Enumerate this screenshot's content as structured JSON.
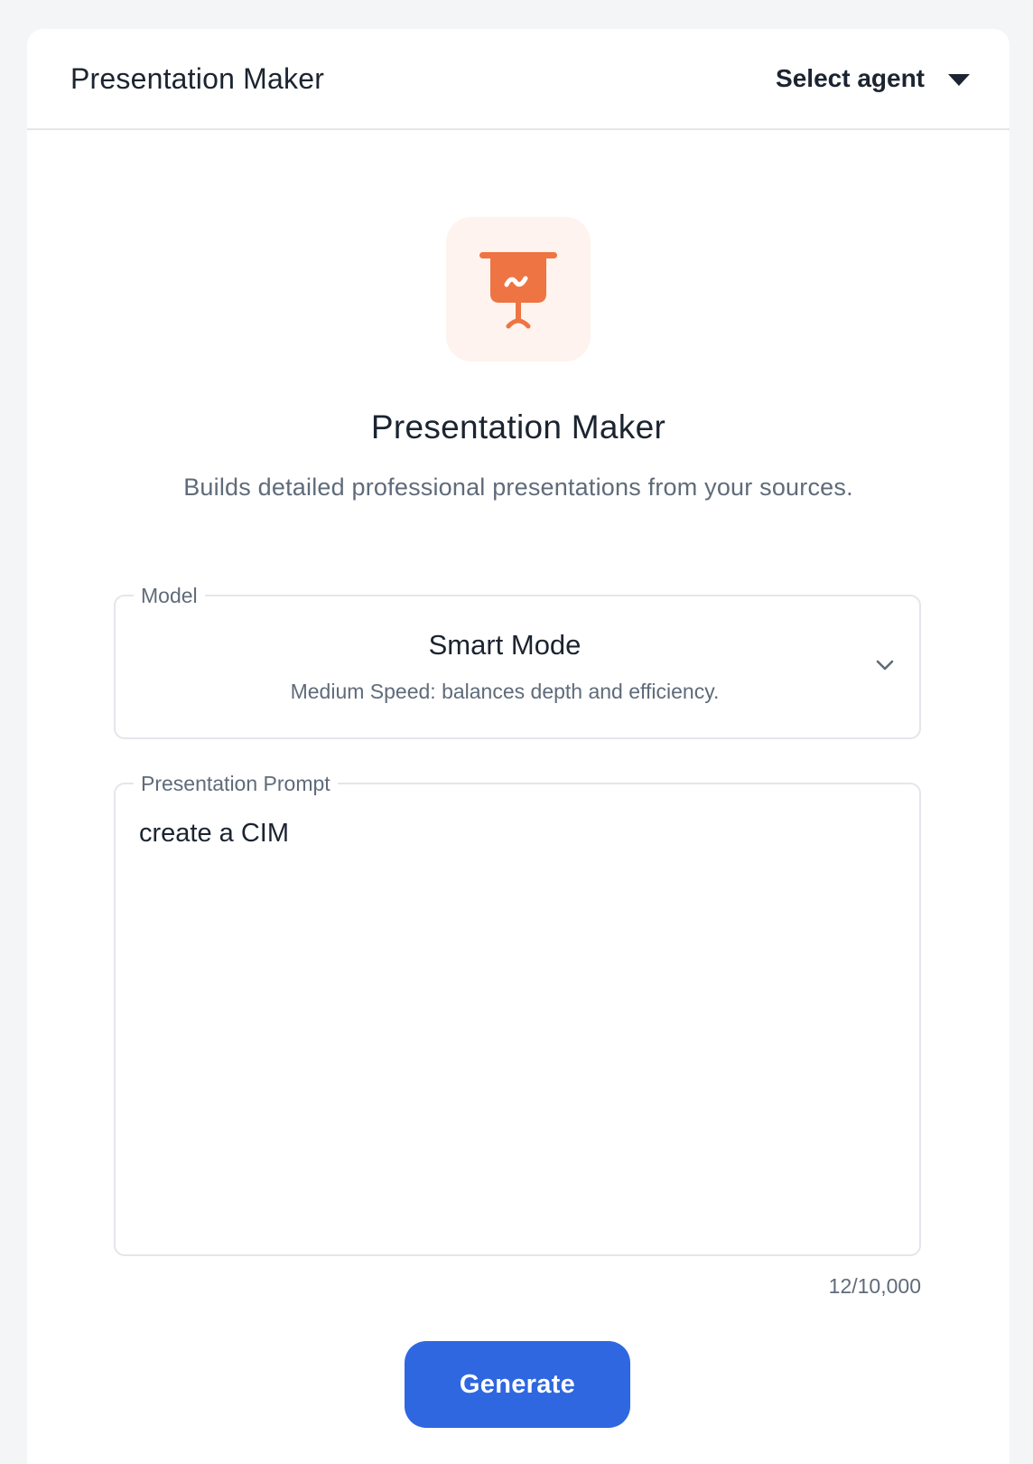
{
  "header": {
    "title": "Presentation Maker",
    "agent_select_label": "Select agent"
  },
  "agent": {
    "icon": "presentation-board-icon",
    "name": "Presentation Maker",
    "description": "Builds detailed professional presentations from your sources."
  },
  "model": {
    "legend": "Model",
    "selected_name": "Smart Mode",
    "selected_description": "Medium Speed: balances depth and efficiency."
  },
  "prompt": {
    "legend": "Presentation Prompt",
    "value": "create a CIM",
    "char_count": "12/10,000"
  },
  "actions": {
    "generate_label": "Generate"
  },
  "colors": {
    "accent": "#2e67e0",
    "icon_orange": "#ee7443",
    "icon_tile_bg": "#fef3ee"
  }
}
